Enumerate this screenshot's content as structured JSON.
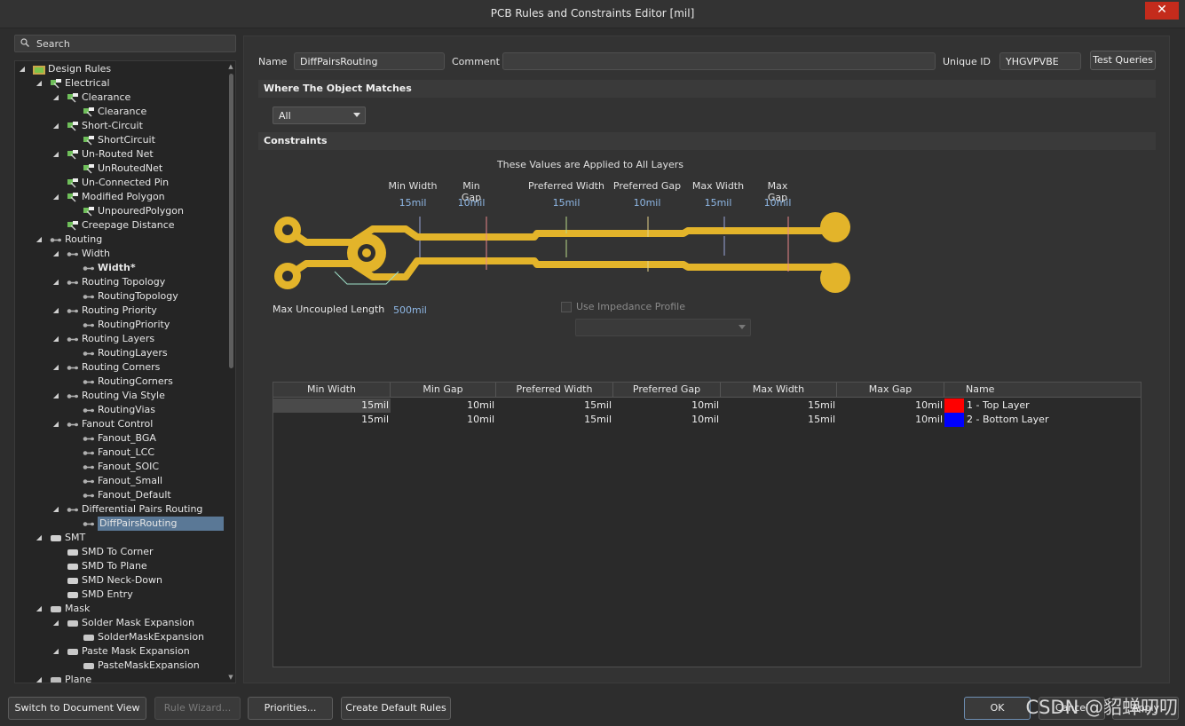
{
  "window": {
    "title": "PCB Rules and Constraints Editor [mil]",
    "close_glyph": "✕"
  },
  "search": {
    "placeholder": "Search"
  },
  "tree": [
    {
      "label": "Design Rules",
      "level": 0,
      "expander": "◢",
      "icon": "design-rules-icon"
    },
    {
      "label": "Electrical",
      "level": 1,
      "expander": "◢",
      "icon": "rule-category-icon"
    },
    {
      "label": "Clearance",
      "level": 2,
      "expander": "◢",
      "icon": "rule-type-icon"
    },
    {
      "label": "Clearance",
      "level": 3,
      "expander": "",
      "icon": "rule-icon"
    },
    {
      "label": "Short-Circuit",
      "level": 2,
      "expander": "◢",
      "icon": "rule-type-icon"
    },
    {
      "label": "ShortCircuit",
      "level": 3,
      "expander": "",
      "icon": "rule-icon"
    },
    {
      "label": "Un-Routed Net",
      "level": 2,
      "expander": "◢",
      "icon": "rule-type-icon"
    },
    {
      "label": "UnRoutedNet",
      "level": 3,
      "expander": "",
      "icon": "rule-icon"
    },
    {
      "label": "Un-Connected Pin",
      "level": 2,
      "expander": "",
      "icon": "rule-type-icon"
    },
    {
      "label": "Modified Polygon",
      "level": 2,
      "expander": "◢",
      "icon": "rule-type-icon"
    },
    {
      "label": "UnpouredPolygon",
      "level": 3,
      "expander": "",
      "icon": "rule-icon"
    },
    {
      "label": "Creepage Distance",
      "level": 2,
      "expander": "",
      "icon": "rule-type-icon"
    },
    {
      "label": "Routing",
      "level": 1,
      "expander": "◢",
      "icon": "routing-icon"
    },
    {
      "label": "Width",
      "level": 2,
      "expander": "◢",
      "icon": "routing-icon"
    },
    {
      "label": "Width*",
      "level": 3,
      "expander": "",
      "icon": "routing-icon",
      "bold": true
    },
    {
      "label": "Routing Topology",
      "level": 2,
      "expander": "◢",
      "icon": "routing-icon"
    },
    {
      "label": "RoutingTopology",
      "level": 3,
      "expander": "",
      "icon": "routing-icon"
    },
    {
      "label": "Routing Priority",
      "level": 2,
      "expander": "◢",
      "icon": "routing-icon"
    },
    {
      "label": "RoutingPriority",
      "level": 3,
      "expander": "",
      "icon": "routing-icon"
    },
    {
      "label": "Routing Layers",
      "level": 2,
      "expander": "◢",
      "icon": "routing-icon"
    },
    {
      "label": "RoutingLayers",
      "level": 3,
      "expander": "",
      "icon": "routing-icon"
    },
    {
      "label": "Routing Corners",
      "level": 2,
      "expander": "◢",
      "icon": "routing-icon"
    },
    {
      "label": "RoutingCorners",
      "level": 3,
      "expander": "",
      "icon": "routing-icon"
    },
    {
      "label": "Routing Via Style",
      "level": 2,
      "expander": "◢",
      "icon": "routing-icon"
    },
    {
      "label": "RoutingVias",
      "level": 3,
      "expander": "",
      "icon": "routing-icon"
    },
    {
      "label": "Fanout Control",
      "level": 2,
      "expander": "◢",
      "icon": "routing-icon"
    },
    {
      "label": "Fanout_BGA",
      "level": 3,
      "expander": "",
      "icon": "routing-icon"
    },
    {
      "label": "Fanout_LCC",
      "level": 3,
      "expander": "",
      "icon": "routing-icon"
    },
    {
      "label": "Fanout_SOIC",
      "level": 3,
      "expander": "",
      "icon": "routing-icon"
    },
    {
      "label": "Fanout_Small",
      "level": 3,
      "expander": "",
      "icon": "routing-icon"
    },
    {
      "label": "Fanout_Default",
      "level": 3,
      "expander": "",
      "icon": "routing-icon"
    },
    {
      "label": "Differential Pairs Routing",
      "level": 2,
      "expander": "◢",
      "icon": "routing-icon"
    },
    {
      "label": "DiffPairsRouting",
      "level": 3,
      "expander": "",
      "icon": "routing-icon",
      "selected": true
    },
    {
      "label": "SMT",
      "level": 1,
      "expander": "◢",
      "icon": "smt-icon"
    },
    {
      "label": "SMD To Corner",
      "level": 2,
      "expander": "",
      "icon": "smt-icon"
    },
    {
      "label": "SMD To Plane",
      "level": 2,
      "expander": "",
      "icon": "smt-icon"
    },
    {
      "label": "SMD Neck-Down",
      "level": 2,
      "expander": "",
      "icon": "smt-icon"
    },
    {
      "label": "SMD Entry",
      "level": 2,
      "expander": "",
      "icon": "smt-icon"
    },
    {
      "label": "Mask",
      "level": 1,
      "expander": "◢",
      "icon": "mask-icon"
    },
    {
      "label": "Solder Mask Expansion",
      "level": 2,
      "expander": "◢",
      "icon": "mask-icon"
    },
    {
      "label": "SolderMaskExpansion",
      "level": 3,
      "expander": "",
      "icon": "mask-icon"
    },
    {
      "label": "Paste Mask Expansion",
      "level": 2,
      "expander": "◢",
      "icon": "mask-icon"
    },
    {
      "label": "PasteMaskExpansion",
      "level": 3,
      "expander": "",
      "icon": "mask-icon"
    },
    {
      "label": "Plane",
      "level": 1,
      "expander": "◢",
      "icon": "plane-icon"
    }
  ],
  "rule": {
    "name_label": "Name",
    "name": "DiffPairsRouting",
    "comment_label": "Comment",
    "comment": "",
    "uid_label": "Unique ID",
    "uid": "YHGVPVBE",
    "test_queries": "Test Queries"
  },
  "match": {
    "title": "Where The Object Matches",
    "selected": "All"
  },
  "constraints": {
    "title": "Constraints",
    "applied_note": "These Values are Applied to All Layers",
    "params": [
      {
        "label": "Min Width",
        "value": "15mil"
      },
      {
        "label": "Min Gap",
        "value": "10mil"
      },
      {
        "label": "Preferred Width",
        "value": "15mil"
      },
      {
        "label": "Preferred Gap",
        "value": "10mil"
      },
      {
        "label": "Max Width",
        "value": "15mil"
      },
      {
        "label": "Max Gap",
        "value": "10mil"
      }
    ],
    "max_uncoupled_label": "Max Uncoupled Length",
    "max_uncoupled_value": "500mil",
    "impedance_label": "Use Impedance Profile",
    "impedance_checked": false
  },
  "grid": {
    "headers": [
      "Min Width",
      "Min Gap",
      "Preferred Width",
      "Preferred Gap",
      "Max Width",
      "Max Gap",
      "Name"
    ],
    "rows": [
      {
        "cells": [
          "15mil",
          "10mil",
          "15mil",
          "10mil",
          "15mil",
          "10mil"
        ],
        "color": "#ff0000",
        "name": "1 - Top Layer"
      },
      {
        "cells": [
          "15mil",
          "10mil",
          "15mil",
          "10mil",
          "15mil",
          "10mil"
        ],
        "color": "#0000ff",
        "name": "2 - Bottom Layer"
      }
    ]
  },
  "buttons": {
    "switch_view": "Switch to Document View",
    "rule_wizard": "Rule Wizard...",
    "priorities": "Priorities...",
    "create_defaults": "Create Default Rules",
    "ok": "OK",
    "cancel": "Cancel",
    "apply": "Apply"
  },
  "watermark": "CSDN @貂蝉叨叨",
  "colors": {
    "trace": "#e3b42a",
    "selection": "#5a7896",
    "accent_value": "#8fb8e6"
  }
}
